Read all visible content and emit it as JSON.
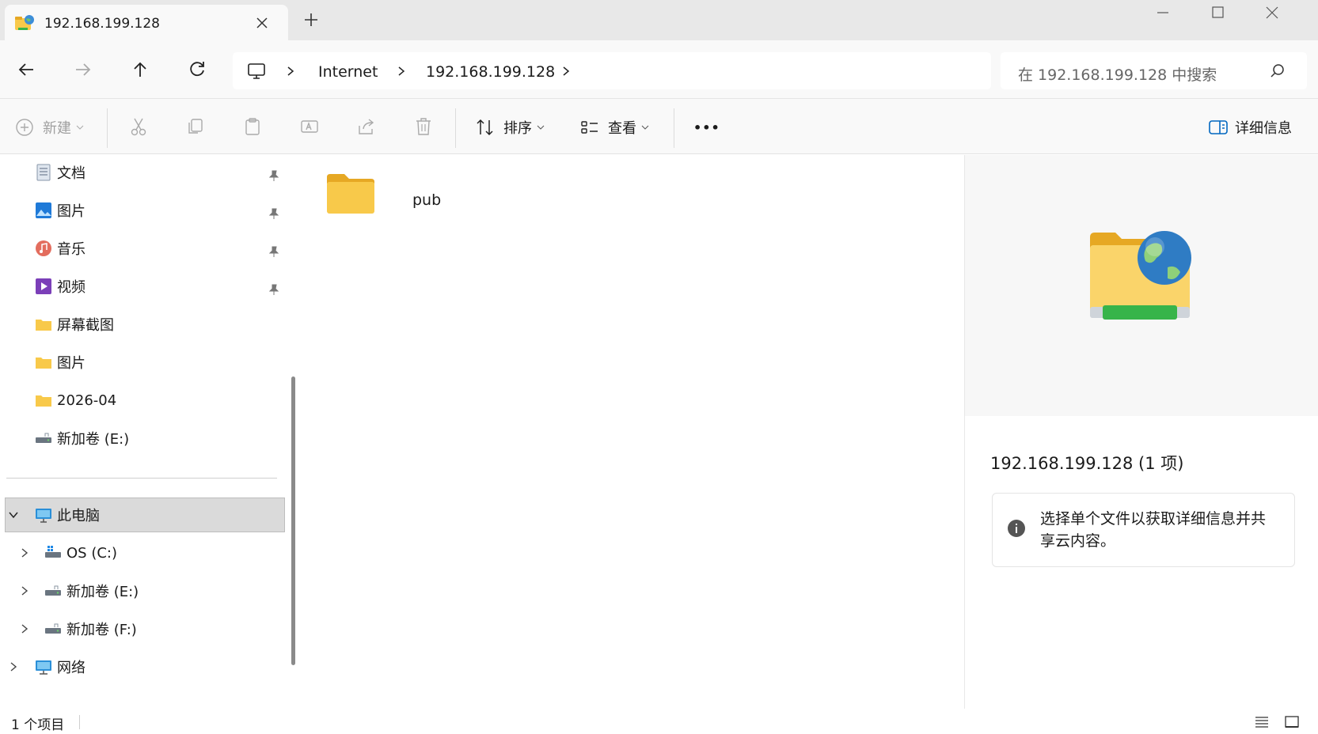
{
  "tab": {
    "title": "192.168.199.128"
  },
  "breadcrumb": {
    "items": [
      "Internet",
      "192.168.199.128"
    ]
  },
  "search": {
    "placeholder": "在 192.168.199.128 中搜索"
  },
  "toolbar": {
    "new_label": "新建",
    "sort_label": "排序",
    "view_label": "查看",
    "more_label": "•••",
    "details_label": "详细信息"
  },
  "sidebar": {
    "quick_access": [
      {
        "label": "文档",
        "icon": "documents-icon",
        "pinned": true
      },
      {
        "label": "图片",
        "icon": "pictures-icon",
        "pinned": true
      },
      {
        "label": "音乐",
        "icon": "music-icon",
        "pinned": true
      },
      {
        "label": "视频",
        "icon": "videos-icon",
        "pinned": true
      },
      {
        "label": "屏幕截图",
        "icon": "folder-icon",
        "pinned": false
      },
      {
        "label": "图片",
        "icon": "folder-icon",
        "pinned": false
      },
      {
        "label": "2026-04",
        "icon": "folder-icon",
        "pinned": false
      },
      {
        "label": "新加卷 (E:)",
        "icon": "drive-icon",
        "pinned": false
      }
    ],
    "this_pc": {
      "label": "此电脑",
      "expanded": true
    },
    "drives": [
      {
        "label": "OS (C:)",
        "icon": "windows-drive-icon"
      },
      {
        "label": "新加卷 (E:)",
        "icon": "drive-icon"
      },
      {
        "label": "新加卷 (F:)",
        "icon": "drive-icon"
      }
    ],
    "network": {
      "label": "网络"
    }
  },
  "content": {
    "items": [
      {
        "name": "pub",
        "type": "folder"
      }
    ]
  },
  "details": {
    "title": "192.168.199.128 (1 项)",
    "info": "选择单个文件以获取详细信息并共享云内容。"
  },
  "status": {
    "count": "1 个项目"
  },
  "colors": {
    "folder": "#f8c94a",
    "accent": "#0067c0",
    "selected_bg": "#dadada"
  }
}
